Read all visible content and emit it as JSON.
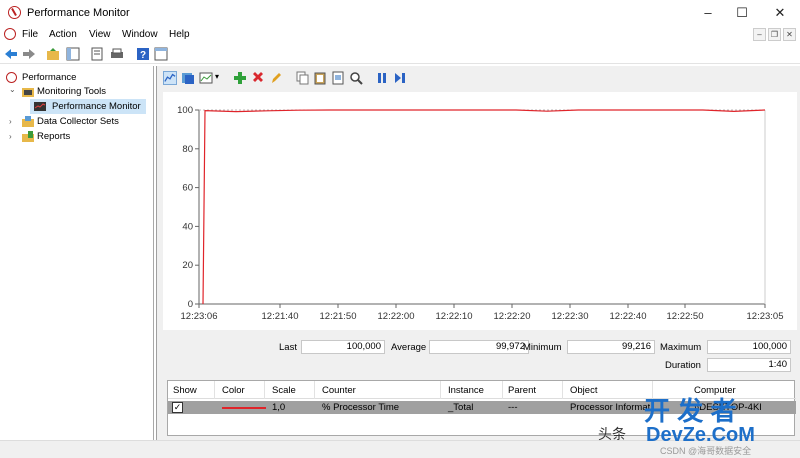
{
  "window": {
    "title": "Performance Monitor"
  },
  "menu": [
    "File",
    "Action",
    "View",
    "Window",
    "Help"
  ],
  "tree": [
    {
      "label": "Performance",
      "level": 0,
      "expander": ""
    },
    {
      "label": "Monitoring Tools",
      "level": 1,
      "expander": "⌄"
    },
    {
      "label": "Performance Monitor",
      "level": 2,
      "expander": "",
      "selected": true
    },
    {
      "label": "Data Collector Sets",
      "level": 1,
      "expander": "›"
    },
    {
      "label": "Reports",
      "level": 1,
      "expander": "›"
    }
  ],
  "chart_data": {
    "type": "line",
    "ylim": [
      0,
      100
    ],
    "yticks": [
      "100",
      "80",
      "60",
      "40",
      "20",
      "0"
    ],
    "xticks": [
      "12:23:06",
      "12:21:40",
      "12:21:50",
      "12:22:00",
      "12:22:10",
      "12:22:20",
      "12:22:30",
      "12:22:40",
      "12:22:50",
      "12:23:05"
    ],
    "series": [
      {
        "color": "#e0242a",
        "x": [
          "12:23:06",
          "12:21:35",
          "12:21:40",
          "12:21:45",
          "12:21:50",
          "12:21:55",
          "12:22:00",
          "12:22:05",
          "12:22:10",
          "12:22:15",
          "12:22:20",
          "12:22:25",
          "12:22:30",
          "12:22:35",
          "12:22:40",
          "12:22:45",
          "12:22:50",
          "12:22:55",
          "12:23:00",
          "12:23:05"
        ],
        "values": [
          0,
          99.7,
          99.2,
          99.6,
          99.9,
          100,
          100,
          100,
          100,
          100,
          100,
          100,
          99.4,
          100,
          100,
          100,
          100,
          100,
          99.3,
          100
        ]
      }
    ]
  },
  "stats": {
    "last_label": "Last",
    "last_value": "100,000",
    "average_label": "Average",
    "average_value": "99,972",
    "minimum_label": "Minimum",
    "minimum_value": "99,216",
    "maximum_label": "Maximum",
    "maximum_value": "100,000",
    "duration_label": "Duration",
    "duration_value": "1:40"
  },
  "counters": {
    "headers": [
      "Show",
      "Color",
      "Scale",
      "Counter",
      "Instance",
      "Parent",
      "Object",
      "Computer"
    ],
    "rows": [
      {
        "show": "✓",
        "color": "#e0242a",
        "scale": "1,0",
        "counter": "% Processor Time",
        "instance": "_Total",
        "parent": "---",
        "object": "Processor Informatio",
        "computer": "\\\\DESKTOP-4KI"
      }
    ]
  },
  "watermark": {
    "text1": "头条",
    "text2": "开 发 者",
    "text3": "DevZe.CoM",
    "text4": "CSDN @海哥数据安全"
  }
}
